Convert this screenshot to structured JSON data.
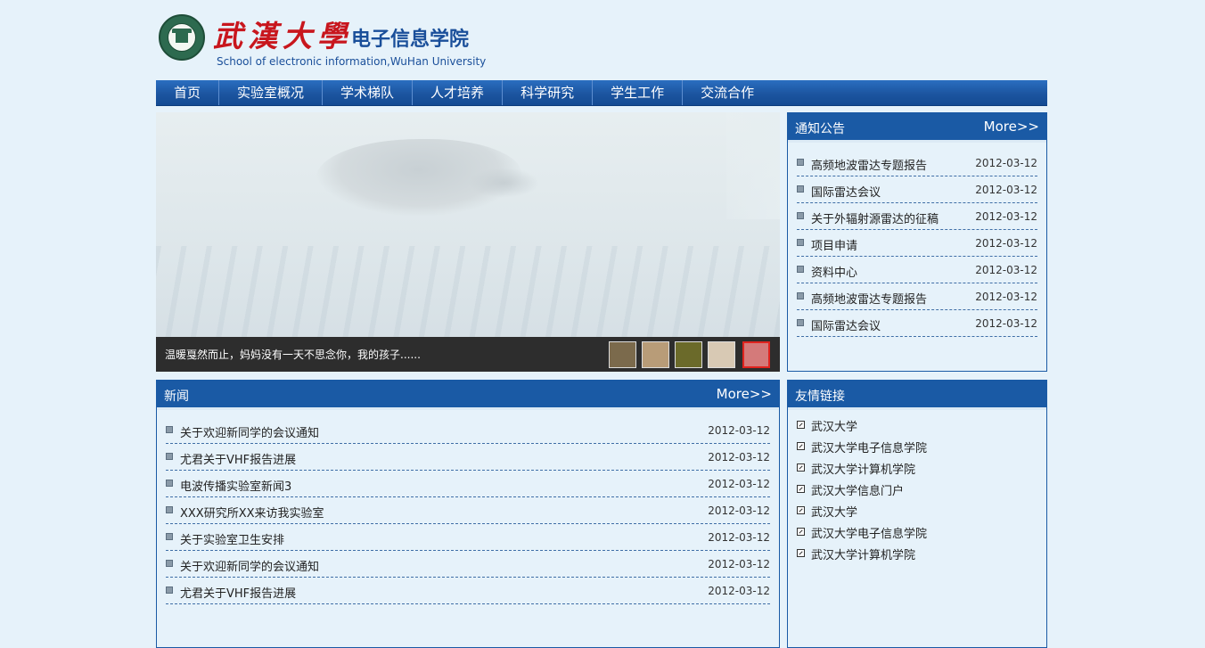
{
  "header": {
    "logo_calligraphy": "武漢大學",
    "school_name_cn": "电子信息学院",
    "school_name_en": "School of electronic information,WuHan University"
  },
  "nav": {
    "items": [
      "首页",
      "实验室概况",
      "学术梯队",
      "人才培养",
      "科学研究",
      "学生工作",
      "交流合作"
    ]
  },
  "slider": {
    "caption": "温暖戛然而止，妈妈没有一天不思念你，我的孩子......",
    "active_thumb": 4,
    "thumbs": [
      {
        "name": "thumb-1",
        "color": "#7b6a4c"
      },
      {
        "name": "thumb-2",
        "color": "#b89c78"
      },
      {
        "name": "thumb-3",
        "color": "#6b6a2a"
      },
      {
        "name": "thumb-4",
        "color": "#d8c9b4"
      },
      {
        "name": "thumb-5",
        "color": "#d47a7a"
      }
    ]
  },
  "notices": {
    "title": "通知公告",
    "more": "More>>",
    "items": [
      {
        "title": "高频地波雷达专题报告",
        "date": "2012-03-12"
      },
      {
        "title": "国际雷达会议",
        "date": "2012-03-12"
      },
      {
        "title": "关于外辐射源雷达的征稿",
        "date": "2012-03-12"
      },
      {
        "title": "项目申请",
        "date": "2012-03-12"
      },
      {
        "title": "资料中心",
        "date": "2012-03-12"
      },
      {
        "title": "高频地波雷达专题报告",
        "date": "2012-03-12"
      },
      {
        "title": "国际雷达会议",
        "date": "2012-03-12"
      }
    ]
  },
  "news": {
    "title": "新闻",
    "more": "More>>",
    "items": [
      {
        "title": "关于欢迎新同学的会议通知",
        "date": "2012-03-12"
      },
      {
        "title": "尤君关于VHF报告进展",
        "date": "2012-03-12"
      },
      {
        "title": "电波传播实验室新闻3",
        "date": "2012-03-12"
      },
      {
        "title": "XXX研究所XX来访我实验室",
        "date": "2012-03-12"
      },
      {
        "title": "关于实验室卫生安排",
        "date": "2012-03-12"
      },
      {
        "title": "关于欢迎新同学的会议通知",
        "date": "2012-03-12"
      },
      {
        "title": "尤君关于VHF报告进展",
        "date": "2012-03-12"
      }
    ]
  },
  "links": {
    "title": "友情链接",
    "items": [
      "武汉大学",
      "武汉大学电子信息学院",
      "武汉大学计算机学院",
      "武汉大学信息门户",
      "武汉大学",
      "武汉大学电子信息学院",
      "武汉大学计算机学院"
    ]
  },
  "colors": {
    "accent": "#1a5aa5",
    "background": "#e6f2fa",
    "logo_red": "#c8161d"
  }
}
